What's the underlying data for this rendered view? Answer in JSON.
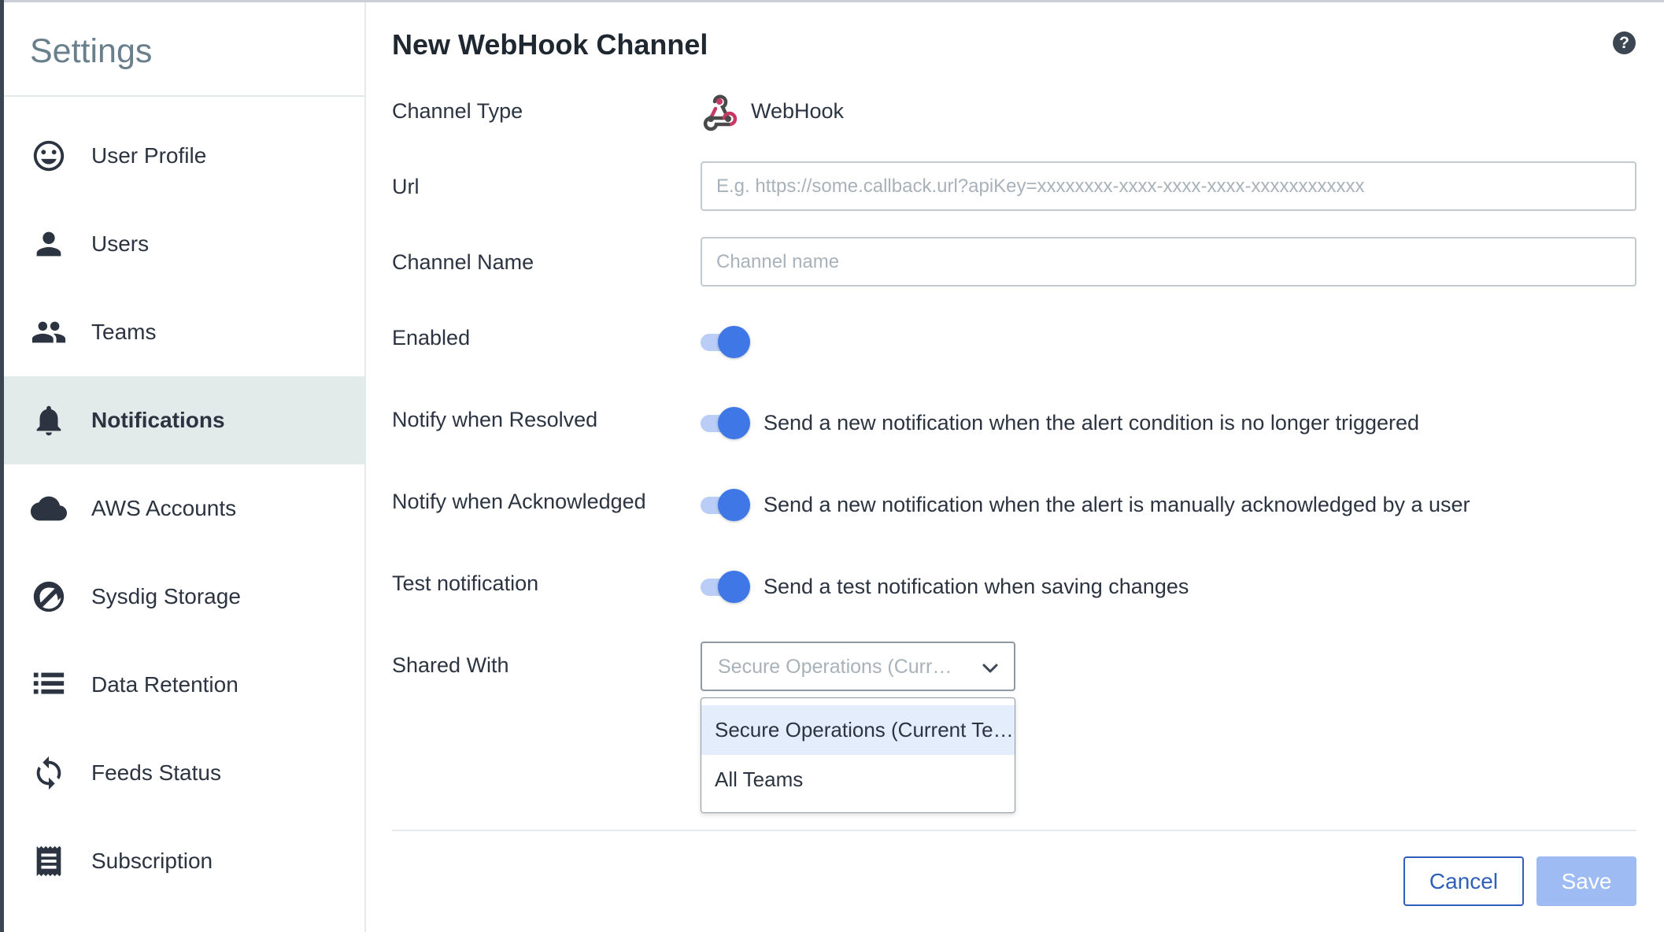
{
  "sidebar": {
    "title": "Settings",
    "items": [
      {
        "label": "User Profile",
        "icon": "smiley-icon",
        "active": false
      },
      {
        "label": "Users",
        "icon": "person-icon",
        "active": false
      },
      {
        "label": "Teams",
        "icon": "group-icon",
        "active": false
      },
      {
        "label": "Notifications",
        "icon": "bell-icon",
        "active": true
      },
      {
        "label": "AWS Accounts",
        "icon": "cloud-icon",
        "active": false
      },
      {
        "label": "Sysdig Storage",
        "icon": "storage-icon",
        "active": false
      },
      {
        "label": "Data Retention",
        "icon": "list-icon",
        "active": false
      },
      {
        "label": "Feeds Status",
        "icon": "sync-icon",
        "active": false
      },
      {
        "label": "Subscription",
        "icon": "receipt-icon",
        "active": false
      }
    ]
  },
  "main": {
    "title": "New WebHook Channel",
    "help_icon": "?",
    "fields": {
      "channel_type": {
        "label": "Channel Type",
        "value": "WebHook",
        "icon": "webhook-icon"
      },
      "url": {
        "label": "Url",
        "value": "",
        "placeholder": "E.g. https://some.callback.url?apiKey=xxxxxxxx-xxxx-xxxx-xxxx-xxxxxxxxxxxx"
      },
      "channel_name": {
        "label": "Channel Name",
        "value": "",
        "placeholder": "Channel name"
      },
      "enabled": {
        "label": "Enabled",
        "on": true
      },
      "notify_resolved": {
        "label": "Notify when Resolved",
        "on": true,
        "description": "Send a new notification when the alert condition is no longer triggered"
      },
      "notify_acknowledged": {
        "label": "Notify when Acknowledged",
        "on": true,
        "description": "Send a new notification when the alert is manually acknowledged by a user"
      },
      "test_notification": {
        "label": "Test notification",
        "on": true,
        "description": "Send a test notification when saving changes"
      },
      "shared_with": {
        "label": "Shared With",
        "selected": "Secure Operations (Current Team)",
        "options": [
          "Secure Operations (Current Team)",
          "All Teams"
        ]
      }
    }
  },
  "footer": {
    "cancel_label": "Cancel",
    "save_label": "Save"
  },
  "colors": {
    "accent": "#3f77e6",
    "active_nav_bg": "#e2eaea",
    "save_disabled": "#9ebcf3",
    "cancel_border": "#2f5fb9"
  }
}
